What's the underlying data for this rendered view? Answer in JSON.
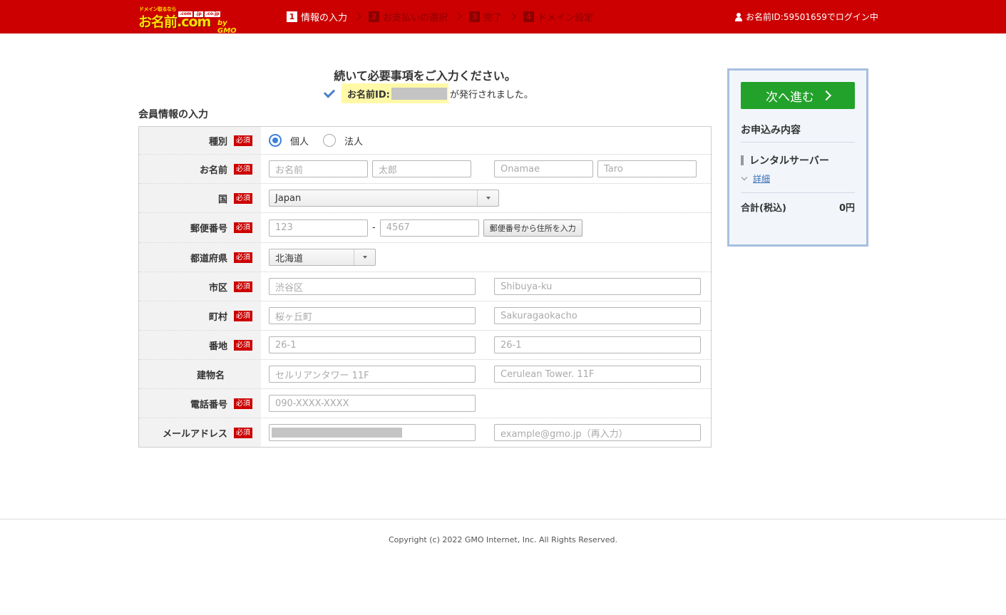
{
  "header": {
    "logo": {
      "tagline": "ドメイン取るなら",
      "brand": "お名前.com",
      "tlds": [
        ".com",
        ".jp",
        ".co.jp"
      ],
      "by": "by GMO"
    },
    "steps": [
      {
        "num": "1",
        "label": "情報の入力"
      },
      {
        "num": "2",
        "label": "お支払いの選択"
      },
      {
        "num": "3",
        "label": "完了"
      },
      {
        "num": "4",
        "label": "ドメイン設定"
      }
    ],
    "login_text": "お名前ID:59501659でログイン中"
  },
  "main": {
    "heading": "続いて必要事項をご入力ください。",
    "issued_prefix": "お名前ID:",
    "issued_suffix": "が発行されました。",
    "section_title": "会員情報の入力",
    "required_badge": "必須"
  },
  "form": {
    "type": {
      "label": "種別",
      "options": [
        "個人",
        "法人"
      ],
      "selected": "個人"
    },
    "name": {
      "label": "お名前",
      "placeholders": [
        "お名前",
        "太郎",
        "Onamae",
        "Taro"
      ]
    },
    "country": {
      "label": "国",
      "value": "Japan"
    },
    "zip": {
      "label": "郵便番号",
      "placeholders": [
        "123",
        "4567"
      ],
      "separator": "-",
      "button": "郵便番号から住所を入力"
    },
    "prefecture": {
      "label": "都道府県",
      "value": "北海道"
    },
    "city": {
      "label": "市区",
      "placeholders": [
        "渋谷区",
        "Shibuya-ku"
      ]
    },
    "town": {
      "label": "町村",
      "placeholders": [
        "桜ヶ丘町",
        "Sakuragaokacho"
      ]
    },
    "block": {
      "label": "番地",
      "placeholders": [
        "26-1",
        "26-1"
      ]
    },
    "building": {
      "label": "建物名",
      "placeholders": [
        "セルリアンタワー 11F",
        "Cerulean Tower. 11F"
      ]
    },
    "phone": {
      "label": "電話番号",
      "placeholder": "090-XXXX-XXXX"
    },
    "email": {
      "label": "メールアドレス",
      "confirm_placeholder": "example@gmo.jp（再入力）"
    }
  },
  "sidebar": {
    "next_button": "次へ進む",
    "title": "お申込み内容",
    "item": "レンタルサーバー",
    "detail_link": "詳細",
    "total_label": "合計(税込)",
    "total_value": "0円"
  },
  "footer": {
    "copyright": "Copyright (c) 2022 GMO Internet, Inc. All Rights Reserved."
  },
  "colors": {
    "header": "#cc0000",
    "accent_button": "#22a22a",
    "required": "#cc0000",
    "highlight": "#fff9a8"
  }
}
